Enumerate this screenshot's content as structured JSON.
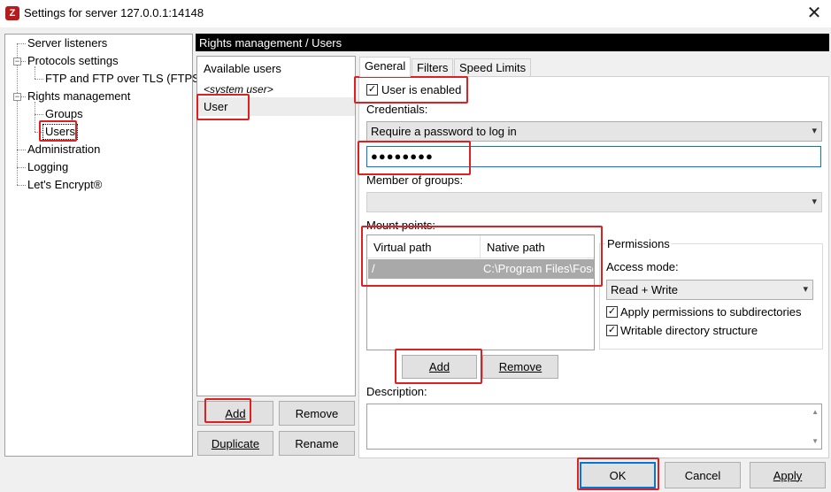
{
  "window": {
    "title": "Settings for server 127.0.0.1:14148",
    "icon_letter": "Z",
    "close_glyph": "✕"
  },
  "tree": {
    "items": [
      {
        "label": "Server listeners"
      },
      {
        "label": "Protocols settings"
      },
      {
        "label": "FTP and FTP over TLS (FTPS)"
      },
      {
        "label": "Rights management"
      },
      {
        "label": "Groups"
      },
      {
        "label": "Users"
      },
      {
        "label": "Administration"
      },
      {
        "label": "Logging"
      },
      {
        "label": "Let's Encrypt®"
      }
    ],
    "selected": "Users"
  },
  "panel": {
    "header": "Rights management / Users"
  },
  "users": {
    "items": [
      "Available users",
      "<system user>",
      "User"
    ],
    "selected": "User",
    "buttons": {
      "add": "Add",
      "remove": "Remove",
      "duplicate": "Duplicate",
      "rename": "Rename"
    }
  },
  "tabs": [
    "General",
    "Filters",
    "Speed Limits"
  ],
  "active_tab": "General",
  "general": {
    "user_enabled_label": "User is enabled",
    "user_enabled": true,
    "credentials_label": "Credentials:",
    "credentials_value": "Require a password to log in",
    "password_value": "●●●●●●●●",
    "member_of_groups_label": "Member of groups:",
    "member_of_groups_value": "",
    "mount_points_label": "Mount points:",
    "mount_columns": [
      "Virtual path",
      "Native path"
    ],
    "mount_rows": [
      {
        "virtual": "/",
        "native": "C:\\Program Files\\Fosc"
      }
    ],
    "mount_buttons": {
      "add": "Add",
      "remove": "Remove"
    },
    "permissions": {
      "legend": "Permissions",
      "access_mode_label": "Access mode:",
      "access_mode_value": "Read + Write",
      "apply_subdirs_label": "Apply permissions to subdirectories",
      "apply_subdirs": true,
      "writable_structure_label": "Writable directory structure",
      "writable_structure": true
    },
    "description_label": "Description:",
    "description_value": ""
  },
  "dialog_buttons": {
    "ok": "OK",
    "cancel": "Cancel",
    "apply": "Apply"
  },
  "icons": {
    "dropdown": "▾",
    "check": "✓",
    "scroll_up": "▲",
    "scroll_down": "▼"
  },
  "colors": {
    "highlight": "#e02020",
    "header_bg": "#000000",
    "focus": "#0078d7"
  }
}
